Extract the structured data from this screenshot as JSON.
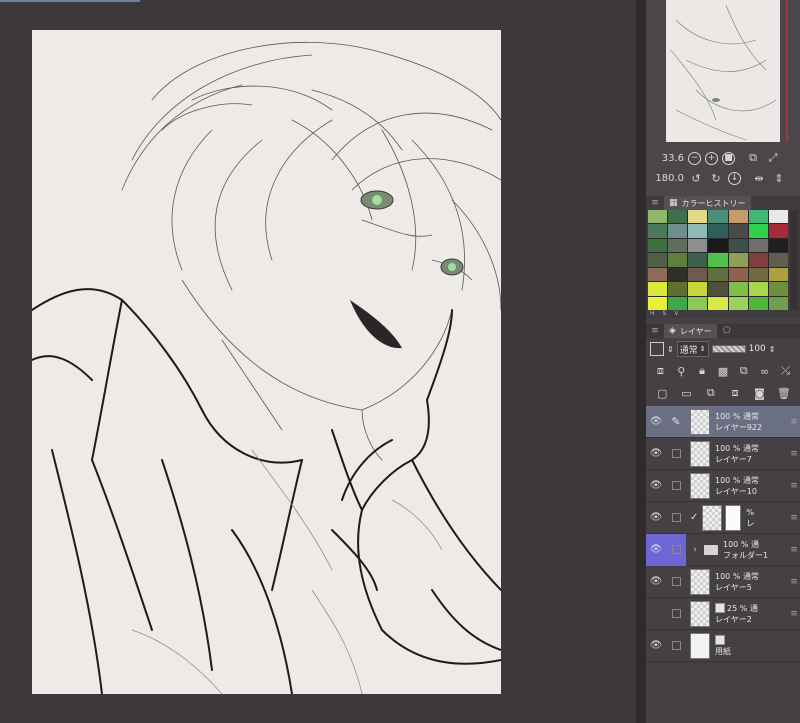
{
  "navigator": {
    "zoom_value": "33.6",
    "rotation_value": "180.0"
  },
  "color_history": {
    "tab_label": "カラーヒストリー",
    "swatches": [
      "#8fb86a",
      "#3f6f4f",
      "#e5d88a",
      "#4b8f7a",
      "#c79a6a",
      "#3fb87a",
      "#e8e8e8",
      "#4a7a5a",
      "#6f8f8f",
      "#8fbab8",
      "#2f5f5a",
      "#4a4a4a",
      "#2fd04a",
      "#a82a3a",
      "#3f6f3f",
      "#5f6f5f",
      "#8f8f8f",
      "#1a1a1a",
      "#3f4f4a",
      "#6f6f6f",
      "#1f1f1f",
      "#4f5f4a",
      "#5f7f3f",
      "#3f5f4f",
      "#4fc04a",
      "#8f9f5a",
      "#7f3f3f",
      "#5f5f4f",
      "#8f6a5a",
      "#2f2f2a",
      "#6f5a4f",
      "#5f6f3f",
      "#8f5f4f",
      "#6f6a3f",
      "#afa03f",
      "#d8e83a",
      "#5f6f2f",
      "#c8d83a",
      "#4f4f3a",
      "#7fbf4a",
      "#a8d84a",
      "#6f8f3a",
      "#e8f03a",
      "#3fa84a",
      "#8fc85a",
      "#d8e84a",
      "#9fd05a",
      "#4fb83a",
      "#6f9f4a"
    ],
    "footer_labels": [
      "H",
      "S",
      "V"
    ]
  },
  "layer_panel": {
    "tab_label": "レイヤー",
    "blend_mode": "通常",
    "opacity": "100",
    "layers": [
      {
        "percent": "100 %",
        "mode": "通常",
        "name": "レイヤー922",
        "type": "raster",
        "visible": true,
        "selected": true,
        "edit_icon": true
      },
      {
        "percent": "100 %",
        "mode": "通常",
        "name": "レイヤー7",
        "type": "raster",
        "visible": true
      },
      {
        "percent": "100 %",
        "mode": "通常",
        "name": "レイヤー10",
        "type": "raster",
        "visible": true
      },
      {
        "percent": "%",
        "mode": "",
        "name": "レ",
        "type": "masked",
        "visible": true
      },
      {
        "percent": "100 %",
        "mode": "通",
        "name": "フォルダー1",
        "type": "folder",
        "visible": true,
        "folder_active": true
      },
      {
        "percent": "100 %",
        "mode": "通常",
        "name": "レイヤー5",
        "type": "raster",
        "visible": true
      },
      {
        "percent": "25 %",
        "mode": "通",
        "name": "レイヤー2",
        "type": "raster-icon",
        "visible": false
      },
      {
        "percent": "",
        "mode": "",
        "name": "用紙",
        "type": "paper",
        "visible": true
      }
    ]
  },
  "colors": {
    "selected_layer": "#6b6f83",
    "folder_highlight": "#6f66d6",
    "canvas_paper": "#eeeae8"
  }
}
